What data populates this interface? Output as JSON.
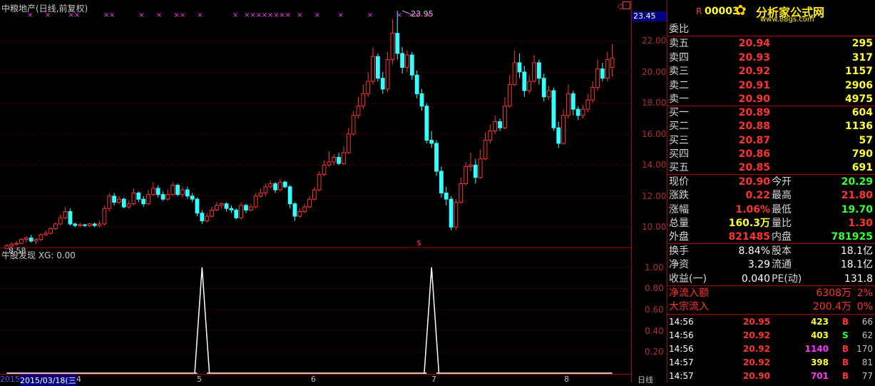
{
  "stock_title": "中粮地产(日线,前复权)",
  "indicator_title": "牛股发现  XG: 0.00",
  "bottom_date": "2015/03/18(三",
  "bottom_date_prefix": "2015",
  "period_label": "日线",
  "panel_code": "00003",
  "panel_code_mark": "R",
  "logo_text": "分析家公式网",
  "logo_url": "www.88gs.com",
  "high_marker_label": "23.95",
  "low_marker_label": "8.58",
  "axis_top_value": "23.45",
  "month_labels": [
    "4",
    "5",
    "6",
    "7",
    "8"
  ],
  "order_ratio_label": "委比",
  "sell_orders": [
    {
      "label": "卖五",
      "price": "20.94",
      "vol": "295"
    },
    {
      "label": "卖四",
      "price": "20.93",
      "vol": "317"
    },
    {
      "label": "卖三",
      "price": "20.92",
      "vol": "1157"
    },
    {
      "label": "卖二",
      "price": "20.91",
      "vol": "2906"
    },
    {
      "label": "卖一",
      "price": "20.90",
      "vol": "4975"
    }
  ],
  "buy_orders": [
    {
      "label": "买一",
      "price": "20.89",
      "vol": "604"
    },
    {
      "label": "买二",
      "price": "20.88",
      "vol": "1136"
    },
    {
      "label": "买三",
      "price": "20.87",
      "vol": "57"
    },
    {
      "label": "买四",
      "price": "20.86",
      "vol": "790"
    },
    {
      "label": "买五",
      "price": "20.85",
      "vol": "691"
    }
  ],
  "quote_stats": [
    {
      "l1": "现价",
      "v1": "20.90",
      "c1": "red",
      "l2": "今开",
      "v2": "20.29",
      "c2": "green"
    },
    {
      "l1": "涨跌",
      "v1": "0.22",
      "c1": "red",
      "l2": "最高",
      "v2": "21.80",
      "c2": "red"
    },
    {
      "l1": "涨幅",
      "v1": "1.06%",
      "c1": "red",
      "l2": "最低",
      "v2": "19.70",
      "c2": "green"
    },
    {
      "l1": "总量",
      "v1": "160.3万",
      "c1": "yellow",
      "l2": "量比",
      "v2": "1.30",
      "c2": "red"
    },
    {
      "l1": "外盘",
      "v1": "821485",
      "c1": "red",
      "l2": "内盘",
      "v2": "781925",
      "c2": "green"
    }
  ],
  "fundamentals": [
    {
      "l1": "换手",
      "v1": "8.84%",
      "l2": "股本",
      "v2": "18.1亿"
    },
    {
      "l1": "净资",
      "v1": "3.29",
      "l2": "流通",
      "v2": "18.1亿"
    },
    {
      "l1": "收益(一)",
      "v1": "0.040",
      "l2": "PE(动)",
      "v2": "131.8"
    }
  ],
  "flows": [
    {
      "label": "净流入额",
      "value": "6308万",
      "pct": "2%"
    },
    {
      "label": "大宗流入",
      "value": "200.4万",
      "pct": "0%"
    }
  ],
  "ticks": [
    {
      "time": "14:56",
      "price": "20.95",
      "vol": "423",
      "vc": "yellow",
      "side": "B",
      "sc": "red",
      "num": "66"
    },
    {
      "time": "14:56",
      "price": "20.92",
      "vol": "403",
      "vc": "yellow",
      "side": "S",
      "sc": "green",
      "num": "62"
    },
    {
      "time": "14:56",
      "price": "20.92",
      "vol": "1140",
      "vc": "mag",
      "side": "B",
      "sc": "red",
      "num": "170"
    },
    {
      "time": "14:57",
      "price": "20.92",
      "vol": "398",
      "vc": "yellow",
      "side": "B",
      "sc": "red",
      "num": "81"
    },
    {
      "time": "14:57",
      "price": "20.90",
      "vol": "701",
      "vc": "mag",
      "side": "B",
      "sc": "red",
      "num": "77"
    }
  ],
  "colors": {
    "up": "#ff3333",
    "down": "#33ffff",
    "bg": "#000000",
    "grid": "#7a0000",
    "signal": "#ff33ff"
  },
  "chart_data": [
    {
      "type": "candlestick",
      "title": "中粮地产(日线,前复权)",
      "ylim": [
        9.0,
        24.0
      ],
      "yticks": [
        10.0,
        12.0,
        14.0,
        16.0,
        18.0,
        20.0,
        22.0
      ],
      "high_label": 23.95,
      "low_label": 8.58,
      "candles": [
        [
          8.6,
          8.8,
          8.9,
          8.58
        ],
        [
          8.8,
          8.9,
          9.0,
          8.7
        ],
        [
          8.9,
          8.95,
          9.1,
          8.8
        ],
        [
          8.95,
          9.2,
          9.3,
          8.9
        ],
        [
          9.2,
          9.3,
          9.4,
          9.0
        ],
        [
          9.3,
          9.1,
          9.5,
          9.0
        ],
        [
          9.1,
          9.2,
          9.3,
          8.9
        ],
        [
          9.2,
          9.5,
          9.6,
          9.1
        ],
        [
          9.5,
          9.6,
          9.8,
          9.4
        ],
        [
          9.6,
          9.9,
          10.0,
          9.5
        ],
        [
          9.9,
          10.2,
          10.3,
          9.8
        ],
        [
          10.2,
          10.6,
          10.8,
          10.1
        ],
        [
          10.6,
          11.0,
          11.3,
          10.5
        ],
        [
          11.0,
          10.2,
          11.2,
          10.1
        ],
        [
          10.2,
          10.1,
          10.3,
          10.0
        ],
        [
          10.1,
          10.15,
          10.3,
          10.0
        ],
        [
          10.15,
          10.1,
          10.2,
          10.0
        ],
        [
          10.1,
          10.2,
          10.3,
          10.0
        ],
        [
          10.2,
          10.1,
          10.3,
          10.0
        ],
        [
          10.1,
          10.2,
          10.4,
          10.0
        ],
        [
          10.2,
          11.2,
          11.4,
          10.1
        ],
        [
          11.2,
          12.0,
          12.2,
          11.0
        ],
        [
          12.0,
          11.6,
          12.2,
          11.4
        ],
        [
          11.6,
          11.8,
          12.0,
          11.5
        ],
        [
          11.8,
          11.3,
          11.9,
          11.2
        ],
        [
          11.3,
          11.5,
          11.7,
          11.2
        ],
        [
          11.5,
          12.2,
          12.5,
          11.4
        ],
        [
          12.2,
          11.8,
          12.3,
          11.6
        ],
        [
          11.8,
          11.5,
          12.0,
          11.3
        ],
        [
          11.5,
          12.1,
          12.4,
          11.4
        ],
        [
          12.1,
          12.5,
          12.9,
          12.0
        ],
        [
          12.5,
          12.1,
          12.7,
          11.9
        ],
        [
          12.1,
          11.8,
          12.3,
          11.7
        ],
        [
          11.8,
          12.1,
          12.4,
          11.7
        ],
        [
          12.1,
          12.7,
          12.9,
          12.0
        ],
        [
          12.7,
          12.1,
          12.8,
          12.0
        ],
        [
          12.1,
          12.4,
          12.6,
          11.9
        ],
        [
          12.4,
          12.0,
          12.6,
          11.8
        ],
        [
          12.0,
          11.8,
          12.2,
          11.6
        ],
        [
          11.8,
          10.9,
          11.9,
          10.7
        ],
        [
          10.9,
          10.4,
          11.1,
          10.2
        ],
        [
          10.4,
          10.7,
          10.9,
          10.3
        ],
        [
          10.7,
          11.1,
          11.3,
          10.6
        ],
        [
          11.1,
          11.4,
          11.6,
          11.0
        ],
        [
          11.4,
          11.5,
          11.6,
          11.2
        ],
        [
          11.5,
          11.2,
          11.6,
          11.0
        ],
        [
          11.2,
          11.1,
          11.4,
          10.9
        ],
        [
          11.1,
          10.6,
          11.2,
          10.5
        ],
        [
          10.6,
          11.4,
          11.6,
          10.5
        ],
        [
          11.4,
          11.1,
          11.5,
          10.9
        ],
        [
          11.1,
          11.3,
          11.5,
          11.0
        ],
        [
          11.3,
          12.0,
          12.2,
          11.2
        ],
        [
          12.0,
          12.2,
          12.5,
          11.9
        ],
        [
          12.2,
          12.6,
          12.8,
          12.0
        ],
        [
          12.6,
          12.8,
          13.0,
          12.5
        ],
        [
          12.8,
          12.4,
          12.9,
          12.2
        ],
        [
          12.4,
          12.9,
          13.1,
          12.3
        ],
        [
          12.9,
          12.6,
          13.0,
          12.5
        ],
        [
          12.6,
          11.5,
          12.7,
          11.2
        ],
        [
          11.5,
          10.7,
          11.6,
          10.4
        ],
        [
          10.7,
          11.0,
          11.2,
          10.6
        ],
        [
          11.0,
          11.3,
          11.5,
          10.9
        ],
        [
          11.3,
          11.8,
          12.0,
          11.2
        ],
        [
          11.8,
          12.4,
          12.6,
          11.7
        ],
        [
          12.4,
          13.4,
          13.6,
          12.3
        ],
        [
          13.4,
          14.0,
          14.3,
          13.3
        ],
        [
          14.0,
          14.2,
          14.9,
          13.9
        ],
        [
          14.2,
          14.5,
          14.7,
          14.0
        ],
        [
          14.5,
          14.1,
          14.8,
          14.0
        ],
        [
          14.1,
          14.8,
          15.2,
          14.0
        ],
        [
          14.8,
          16.0,
          16.4,
          14.7
        ],
        [
          16.0,
          17.2,
          17.5,
          15.9
        ],
        [
          17.2,
          17.8,
          18.4,
          17.0
        ],
        [
          17.8,
          18.6,
          19.2,
          17.6
        ],
        [
          18.6,
          19.4,
          20.0,
          18.4
        ],
        [
          19.4,
          21.0,
          21.6,
          19.2
        ],
        [
          21.0,
          19.6,
          21.2,
          19.4
        ],
        [
          19.6,
          18.9,
          20.0,
          18.6
        ],
        [
          18.9,
          20.8,
          21.3,
          18.7
        ],
        [
          20.8,
          22.5,
          23.4,
          20.5
        ],
        [
          22.5,
          21.2,
          23.95,
          20.8
        ],
        [
          21.2,
          20.3,
          21.6,
          19.9
        ],
        [
          20.3,
          21.1,
          21.4,
          20.0
        ],
        [
          21.1,
          19.8,
          21.3,
          19.5
        ],
        [
          19.8,
          18.6,
          20.1,
          18.3
        ],
        [
          18.6,
          17.8,
          18.9,
          17.5
        ],
        [
          17.8,
          15.6,
          18.0,
          15.4
        ],
        [
          15.6,
          15.4,
          16.2,
          15.1
        ],
        [
          15.4,
          13.6,
          15.6,
          13.3
        ],
        [
          13.6,
          12.2,
          13.9,
          11.9
        ],
        [
          12.2,
          11.8,
          12.6,
          11.4
        ],
        [
          11.8,
          10.0,
          12.0,
          9.8
        ],
        [
          10.0,
          11.6,
          11.8,
          9.8
        ],
        [
          11.6,
          12.8,
          13.2,
          11.5
        ],
        [
          12.8,
          13.9,
          14.2,
          12.7
        ],
        [
          13.9,
          14.0,
          14.8,
          13.6
        ],
        [
          14.0,
          13.2,
          14.4,
          12.8
        ],
        [
          13.2,
          14.4,
          15.0,
          13.1
        ],
        [
          14.4,
          15.6,
          16.1,
          14.3
        ],
        [
          15.6,
          16.2,
          16.6,
          15.4
        ],
        [
          16.2,
          16.8,
          17.2,
          16.0
        ],
        [
          16.8,
          16.4,
          17.0,
          16.2
        ],
        [
          16.4,
          17.8,
          18.4,
          16.3
        ],
        [
          17.8,
          19.2,
          19.8,
          17.7
        ],
        [
          19.2,
          20.6,
          21.4,
          19.1
        ],
        [
          20.6,
          20.0,
          21.2,
          19.6
        ],
        [
          20.0,
          18.8,
          20.4,
          18.4
        ],
        [
          18.8,
          19.4,
          19.8,
          18.6
        ],
        [
          19.4,
          20.6,
          21.1,
          19.3
        ],
        [
          20.6,
          19.6,
          20.8,
          19.2
        ],
        [
          19.6,
          18.4,
          19.9,
          18.1
        ],
        [
          18.4,
          18.8,
          19.1,
          18.2
        ],
        [
          18.8,
          16.4,
          19.0,
          16.2
        ],
        [
          16.4,
          15.4,
          16.8,
          15.1
        ],
        [
          15.4,
          17.2,
          17.6,
          15.3
        ],
        [
          17.2,
          18.6,
          19.2,
          17.0
        ],
        [
          18.6,
          17.6,
          18.8,
          17.2
        ],
        [
          17.6,
          17.2,
          17.8,
          16.9
        ],
        [
          17.2,
          17.6,
          17.9,
          17.0
        ],
        [
          17.6,
          18.2,
          18.6,
          17.4
        ],
        [
          18.2,
          19.0,
          19.4,
          18.0
        ],
        [
          19.0,
          20.2,
          20.8,
          18.8
        ],
        [
          20.2,
          19.6,
          20.6,
          19.4
        ],
        [
          19.6,
          20.8,
          21.3,
          19.4
        ],
        [
          20.29,
          20.9,
          21.8,
          19.7
        ]
      ],
      "signal_rows": [
        1
      ]
    },
    {
      "type": "line",
      "title": "牛股发现  XG: 0.00",
      "ylim": [
        0,
        1.1
      ],
      "yticks": [
        1.0,
        0.8,
        0.6,
        0.4,
        0.2
      ],
      "signal_indices": [
        40,
        87
      ],
      "values_note_free": true
    }
  ]
}
